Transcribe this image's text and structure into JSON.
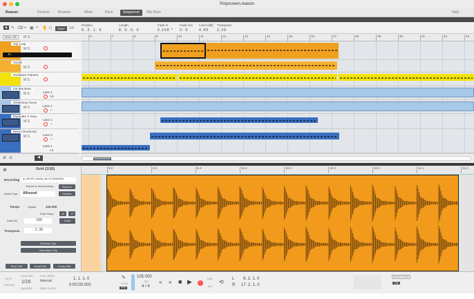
{
  "window": {
    "title": "Polyscreen.reason"
  },
  "tabs": [
    "Reason",
    "Devices",
    "Browser",
    "Mixer",
    "Rack",
    "Sequencer",
    "Flip Rack"
  ],
  "selected_tab": "Sequencer",
  "help": "Help",
  "toolbar": {
    "snap_label": "SNAP",
    "snap_value": "1/4",
    "fields": [
      {
        "label": "Position",
        "value": "9. 2. 1. 0"
      },
      {
        "label": "Length",
        "value": "8. 0. 0. 0"
      },
      {
        "label": "Fade In",
        "value": "0.100 *"
      },
      {
        "label": "Fade Out",
        "value": "0. 0"
      },
      {
        "label": "Level (dB)",
        "value": "4.99"
      },
      {
        "label": "Transpose",
        "value": "2.39"
      }
    ]
  },
  "track_header": {
    "button": "Button 480",
    "m": "M",
    "s": "S"
  },
  "ruler": [
    "6",
    "7",
    "8",
    "9",
    "10",
    "11",
    "12",
    "13",
    "14",
    "15",
    "16",
    "17",
    "18",
    "19",
    "20",
    "21",
    "22",
    "23"
  ],
  "tracks": [
    {
      "name": "Top Loop",
      "color": "#f0a020",
      "lane": ""
    },
    {
      "name": "Vocals",
      "color": "#f5b030",
      "lane": ""
    },
    {
      "name": "Hardware Fatness",
      "color": "#f2e20a",
      "lane": ""
    },
    {
      "name": "Fat 80s Bass",
      "color": "#a8c8e8",
      "lane": "Lane 1",
      "note": "A3"
    },
    {
      "name": "Glistening House",
      "color": "#a8c8e8",
      "lane": "Lane 1",
      "note": "—"
    },
    {
      "name": "Expander X Keys",
      "color": "#3a6ec0",
      "lane": "Lane 1",
      "note": "—"
    },
    {
      "name": "Bass-ChordLead",
      "color": "#3a6ec0",
      "lane": "Lane 3",
      "note": "—",
      "lane2": "Lane 1",
      "note2": "A1"
    }
  ],
  "top_loop_input": "In",
  "editor": {
    "grid": "Grid (1/16)",
    "ruler": [
      "9.2",
      "9.3",
      "9.4",
      "10.1",
      "10.2",
      "10.3",
      "10.4",
      "11.1",
      "11.2"
    ]
  },
  "inspector": {
    "recording_label": "Recording",
    "recording_value": "rp_drm124_steady_top.rx2 (Imported)",
    "bounce_text": "Bounce to new recording",
    "bounce": "Bounce",
    "stretch_label": "Stretch Type",
    "stretch_value": "Allround",
    "disable": "Disable",
    "tempo_label": "Tempo",
    "original_label": "Original",
    "original_value": "104.000",
    "scale_tempo_label": "Scale Tempo",
    "x2": "x2",
    "half": "/2",
    "scale_label": "Scale (%)",
    "scale_value": "100",
    "scale_btn": "Scale",
    "transpose_label": "Transpose",
    "transpose_value": "2 .39",
    "reverse": "Reverse Clip",
    "normalize": "Normalize Clip",
    "slice_edit": "Slice Edit",
    "vocal_edit": "Vocal Edit",
    "comp_edit": "Comp Edit"
  },
  "transport": {
    "keys": "KEYS",
    "groove": "GROOVE",
    "quantize_label": "QUANTIZE",
    "quantize_value": "1/16",
    "quantize_sub": "QUARTER",
    "sync_label": "SYNC MODE",
    "sync_value": "Internal",
    "send_clock": "SEND CLOCK",
    "pos_bars": "1. 1. 1. 0",
    "pos_time": "0:00:00:000",
    "click": "CLICK",
    "pre": "PRE",
    "tempo": "105.000",
    "tap": "TAP",
    "signature": "4 / 4",
    "l_label": "L",
    "l_value": "9. 2. 1. 0",
    "r_label": "R",
    "r_value": "17. 2. 1. 0",
    "dub": "DUB",
    "alt": "ALT",
    "delay_comp": "DELAY COMP",
    "on": "ON"
  }
}
